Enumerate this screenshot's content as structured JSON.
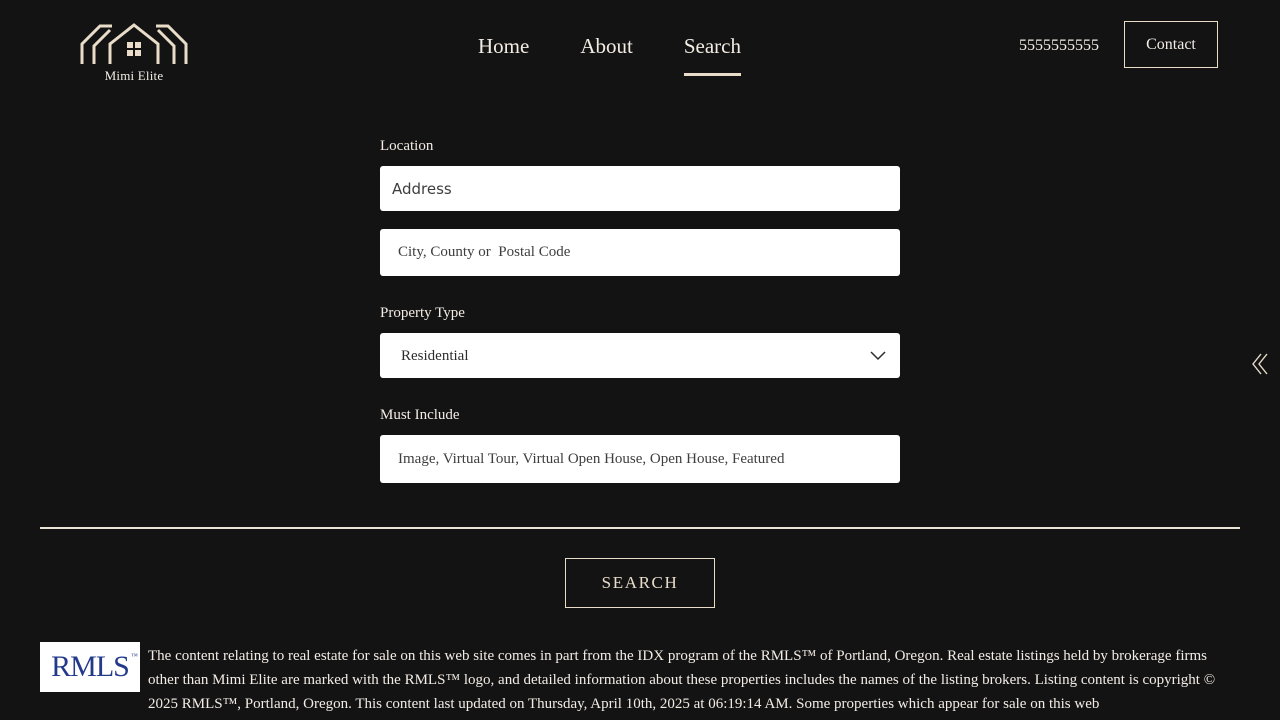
{
  "brand": {
    "name": "Mimi Elite"
  },
  "nav": {
    "items": [
      {
        "label": "Home",
        "active": false
      },
      {
        "label": "About",
        "active": false
      },
      {
        "label": "Search",
        "active": true
      }
    ]
  },
  "header": {
    "phone": "5555555555",
    "contact_label": "Contact"
  },
  "form": {
    "location_label": "Location",
    "address_placeholder": "Address",
    "city_placeholder": "City, County or  Postal Code",
    "property_type_label": "Property Type",
    "property_type_value": "Residential",
    "must_include_label": "Must Include",
    "must_include_value": "Image, Virtual Tour, Virtual Open House, Open House, Featured"
  },
  "search_button": "SEARCH",
  "footer": {
    "logo_text": "RMLS",
    "logo_tm": "™",
    "disclaimer": "The content relating to real estate for sale on this web site comes in part from the IDX program of the RMLS™ of Portland, Oregon. Real estate listings held by brokerage firms other than Mimi Elite are marked with the RMLS™ logo, and detailed information about these properties includes the names of the listing brokers. Listing content is copyright © 2025 RMLS™, Portland, Oregon. This content last updated on Thursday, April 10th, 2025 at 06:19:14 AM. Some properties which appear for sale on this web"
  },
  "colors": {
    "background": "#141314",
    "accent": "#e9dcc9",
    "text": "#f2ece4",
    "rmls_blue": "#233a8a"
  },
  "icons": {
    "logo": "house-outline-logo-icon",
    "select": "chevron-down-icon",
    "side": "double-chevron-left-icon"
  }
}
